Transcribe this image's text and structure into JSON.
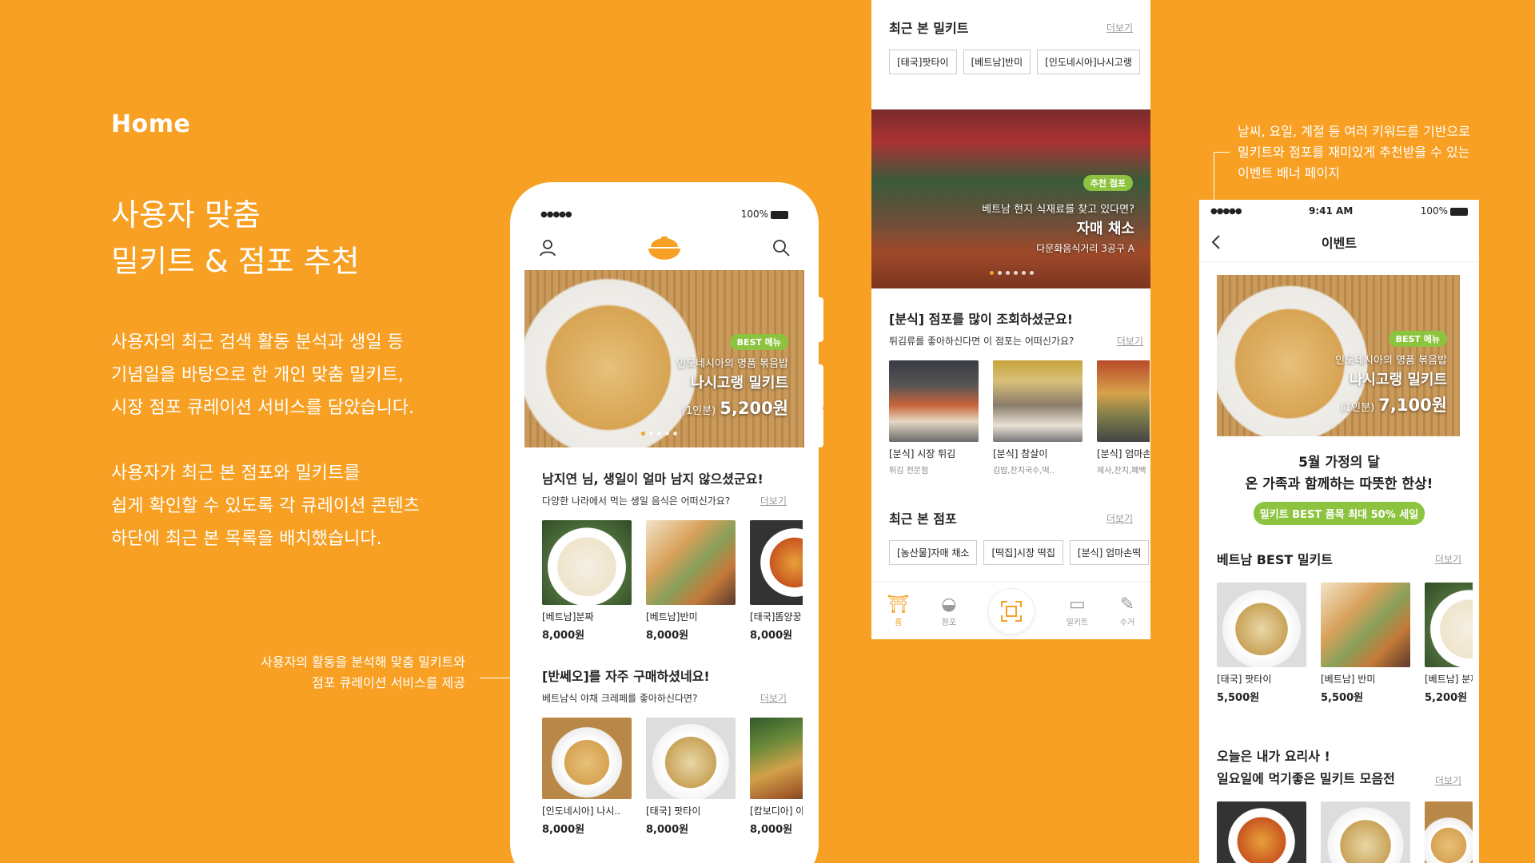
{
  "intro": {
    "home": "Home",
    "title_line1": "사용자 맞춤",
    "title_line2": "밀키트 & 점포 추천",
    "para1": [
      "사용자의 최근 검색 활동 분석과 생일 등",
      "기념일을 바탕으로 한 개인 맞춤 밀키트,",
      "시장 점포 큐레이션 서비스를 담았습니다."
    ],
    "para2": [
      "사용자가 최근 본 점포와 밀키트를",
      "쉽게 확인할 수 있도록 각 큐레이션 콘텐츠",
      "하단에 최근 본 목록을 배치했습니다."
    ],
    "annotation": [
      "사용자의 활동을 분석해 맞춤 밀키트와",
      "점포 큐레이션 서비스를 제공"
    ],
    "annotation_right": [
      "날씨, 요일, 계절 등 여러 키워드를 기반으로",
      "밀키트와 점포를 재미있게 추천받을 수 있는",
      "이벤트 배너 페이지"
    ]
  },
  "phone1": {
    "status": {
      "dots": "●●●●●",
      "battery": "100%"
    },
    "header": {
      "user_icon": "user-icon",
      "logo_icon": "pot-logo-icon",
      "search_icon": "search-icon"
    },
    "hero": {
      "badge": "BEST 메뉴",
      "desc": "인도네시아의 명품 볶음밥",
      "name": "나시고랭 밀키트",
      "unit": "(1인분)",
      "price": "5,200원"
    },
    "section1": {
      "title": "남지연 님, 생일이 얼마 남지 않으셨군요!",
      "sub": "다양한 나라에서 먹는 생일 음식은 어떠신가요?",
      "more": "더보기",
      "items": [
        {
          "name": "[베트남]분짜",
          "price": "8,000원"
        },
        {
          "name": "[베트남]반미",
          "price": "8,000원"
        },
        {
          "name": "[태국]똠양꿍",
          "price": "8,000원"
        }
      ]
    },
    "section2": {
      "title": "[반쎄오]를 자주 구매하셨네요!",
      "sub": "베트남식 야채 크레페를 좋아하신다면?",
      "more": "더보기",
      "items": [
        {
          "name": "[인도네시아] 나시..",
          "price": "8,000원"
        },
        {
          "name": "[태국] 팟타이",
          "price": "8,000원"
        },
        {
          "name": "[캄보디아] 아목",
          "price": "8,000원"
        }
      ]
    }
  },
  "screen2": {
    "recent_kits": {
      "title": "최근 본 밀키트",
      "more": "더보기",
      "chips": [
        "[태국]팟타이",
        "[베트남]반미",
        "[인도네시아]나시고랭"
      ]
    },
    "banner": {
      "badge": "추천 점포",
      "desc": "베트남 현지 식재료를 찾고 있다면?",
      "name": "자매 채소",
      "addr": "다문화음식거리 3공구 A"
    },
    "section": {
      "title": "[분식] 점포를 많이 조회하셨군요!",
      "sub": "튀김류를 좋아하신다면 이 점포는 어떠신가요?",
      "more": "더보기",
      "items": [
        {
          "name": "[분식] 시장 튀김",
          "desc": "튀김 전문점"
        },
        {
          "name": "[분식] 참살이",
          "desc": "김밥,잔치국수,떡.."
        },
        {
          "name": "[분식] 엄마손",
          "desc": "제사,잔치,폐백"
        }
      ]
    },
    "recent_stores": {
      "title": "최근 본 점포",
      "more": "더보기",
      "chips": [
        "[농산물]자매 채소",
        "[떡집]시장 떡집",
        "[분식] 엄마손떡"
      ]
    },
    "tabs": [
      {
        "label": "홈",
        "icon": "home-icon",
        "glyph": "⛩"
      },
      {
        "label": "점포",
        "icon": "store-icon",
        "glyph": "◒"
      },
      {
        "label": "",
        "icon": "scan-icon",
        "glyph": "⌗"
      },
      {
        "label": "밀키트",
        "icon": "mealkit-icon",
        "glyph": "▭"
      },
      {
        "label": "수거",
        "icon": "pickup-icon",
        "glyph": "✎"
      }
    ]
  },
  "screen3": {
    "status": {
      "dots": "●●●●●",
      "time": "9:41 AM",
      "battery": "100%"
    },
    "title": "이벤트",
    "hero": {
      "badge": "BEST 메뉴",
      "desc": "인도네시아의 명품 볶음밥",
      "name": "나시고랭 밀키트",
      "unit": "(1인분)",
      "price": "7,100원"
    },
    "headline1": "5월 가정의 달",
    "headline2": "온 가족과 함께하는 따뜻한 한상!",
    "sale_button": "밀키트 BEST 품목 최대 50% 세일",
    "best": {
      "title": "베트남 BEST 밀키트",
      "more": "더보기",
      "items": [
        {
          "name": "[태국] 팟타이",
          "price": "5,500원"
        },
        {
          "name": "[베트남] 반미",
          "price": "5,500원"
        },
        {
          "name": "[베트남] 분짜",
          "price": "5,200원"
        }
      ]
    },
    "sunday": {
      "title1": "오늘은 내가 요리사 !",
      "title2": "일요일에 먹기좋은 밀키트 모음전",
      "more": "더보기"
    }
  },
  "colors": {
    "background": "#F7A023",
    "accent": "#F7A023",
    "badge_green": "#8DC43F"
  }
}
